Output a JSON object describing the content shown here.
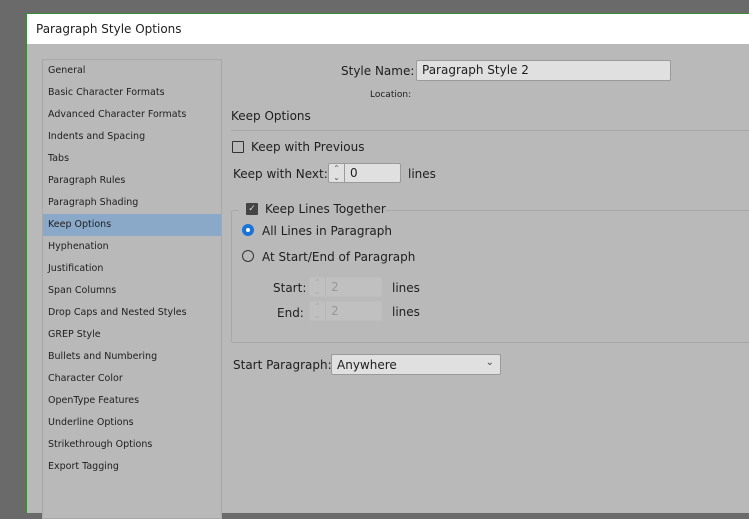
{
  "title": "Paragraph Style Options",
  "sidebar": {
    "items": [
      {
        "label": "General"
      },
      {
        "label": "Basic Character Formats"
      },
      {
        "label": "Advanced Character Formats"
      },
      {
        "label": "Indents and Spacing"
      },
      {
        "label": "Tabs"
      },
      {
        "label": "Paragraph Rules"
      },
      {
        "label": "Paragraph Shading"
      },
      {
        "label": "Keep Options",
        "selected": true
      },
      {
        "label": "Hyphenation"
      },
      {
        "label": "Justification"
      },
      {
        "label": "Span Columns"
      },
      {
        "label": "Drop Caps and Nested Styles"
      },
      {
        "label": "GREP Style"
      },
      {
        "label": "Bullets and Numbering"
      },
      {
        "label": "Character Color"
      },
      {
        "label": "OpenType Features"
      },
      {
        "label": "Underline Options"
      },
      {
        "label": "Strikethrough Options"
      },
      {
        "label": "Export Tagging"
      }
    ]
  },
  "main": {
    "style_name_label": "Style Name:",
    "style_name_value": "Paragraph Style 2",
    "location_label": "Location:",
    "section_title": "Keep Options",
    "keep_with_previous": {
      "label": "Keep with Previous",
      "checked": false
    },
    "keep_with_next": {
      "label": "Keep with Next:",
      "value": "0",
      "unit": "lines"
    },
    "keep_lines_together": {
      "label": "Keep Lines Together",
      "checked": true
    },
    "all_lines": {
      "label": "All Lines in Paragraph",
      "selected": true
    },
    "start_end": {
      "label": "At Start/End of Paragraph",
      "selected": false
    },
    "start": {
      "label": "Start:",
      "value": "2",
      "unit": "lines"
    },
    "end": {
      "label": "End:",
      "value": "2",
      "unit": "lines"
    },
    "start_paragraph": {
      "label": "Start Paragraph:",
      "value": "Anywhere"
    }
  },
  "colors": {
    "selection": "#8aa8c8",
    "radio_accent": "#1a73d9"
  }
}
